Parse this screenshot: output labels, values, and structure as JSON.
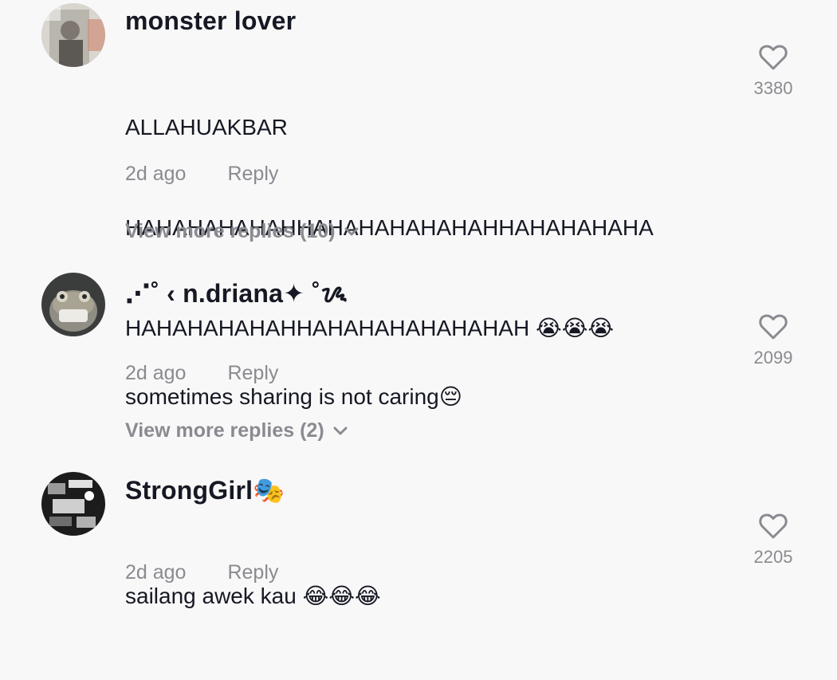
{
  "comments": [
    {
      "username": "monster lover",
      "text_lines": [
        "ALLAHUAKBAR",
        "HAHAHAHAHAHHAHAHAHAHAHAHHAHAHAHAHA",
        "HAHAHAHAHAHHAHAHAHAHAHAHAH 😭😭😭"
      ],
      "time": "2d ago",
      "reply_label": "Reply",
      "likes": "3380",
      "more_replies": "View more replies (10)"
    },
    {
      "username": "⋰˚ ‹ n.driana✦ ˚ᝰ",
      "text_lines": [
        "sometimes sharing is not caring😔"
      ],
      "time": "2d ago",
      "reply_label": "Reply",
      "likes": "2099",
      "more_replies": "View more replies (2)"
    },
    {
      "username": "StrongGirl🎭",
      "text_lines": [
        "sailang awek kau 😂😂😂"
      ],
      "time": "2d ago",
      "reply_label": "Reply",
      "likes": "2205"
    }
  ],
  "colors": {
    "text": "#161823",
    "muted": "#8a8b91",
    "background": "#f8f8f8"
  }
}
